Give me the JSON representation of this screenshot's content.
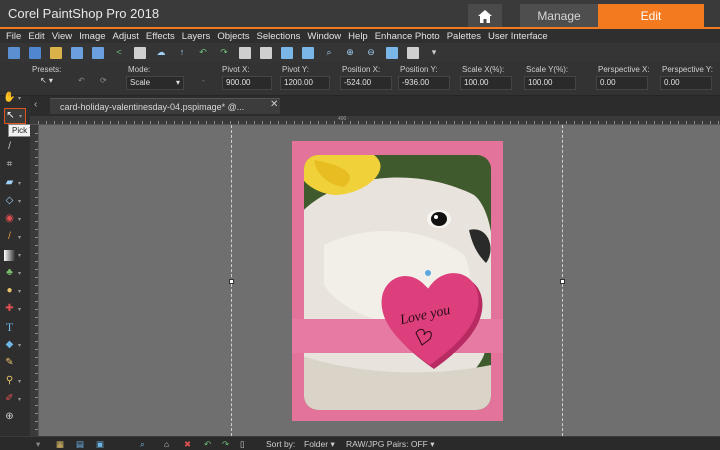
{
  "window": {
    "title": "Corel PaintShop Pro 2018"
  },
  "workspace_tabs": [
    {
      "label": "Manage"
    },
    {
      "label": "Edit"
    }
  ],
  "menubar": {
    "items": [
      "File",
      "Edit",
      "View",
      "Image",
      "Adjust",
      "Effects",
      "Layers",
      "Objects",
      "Selections",
      "Window",
      "Help",
      "Enhance Photo",
      "Palettes",
      "User Interface"
    ]
  },
  "tool_options": {
    "presets_label": "Presets:",
    "mode_label": "Mode:",
    "mode_value": "Scale",
    "pivot_x_label": "Pivot X:",
    "pivot_x_value": "900.00",
    "pivot_y_label": "Pivot Y:",
    "pivot_y_value": "1200.00",
    "position_x_label": "Position X:",
    "position_x_value": "-524.00",
    "position_y_label": "Position Y:",
    "position_y_value": "-936.00",
    "scale_x_label": "Scale X(%):",
    "scale_x_value": "100.00",
    "scale_y_label": "Scale Y(%):",
    "scale_y_value": "100.00",
    "perspective_x_label": "Perspective X:",
    "perspective_x_value": "0.00",
    "perspective_y_label": "Perspective Y:",
    "perspective_y_value": "0.00"
  },
  "toolbox": {
    "tooltip": "Pick Tool (K)"
  },
  "document": {
    "tab_title": "card-holiday-valentinesday-04.pspimage* @...",
    "ruler_mark": "400"
  },
  "canvas": {
    "heart_text": "Love you"
  },
  "organizer_bar": {
    "sort_by_label": "Sort by:",
    "sort_by_value": "Folder",
    "raw_jpg_pairs": "RAW/JPG Pairs: OFF"
  },
  "colors": {
    "accent": "#f47a20",
    "card_pink": "#e4739c",
    "heart_pink": "#dd3f7c"
  }
}
